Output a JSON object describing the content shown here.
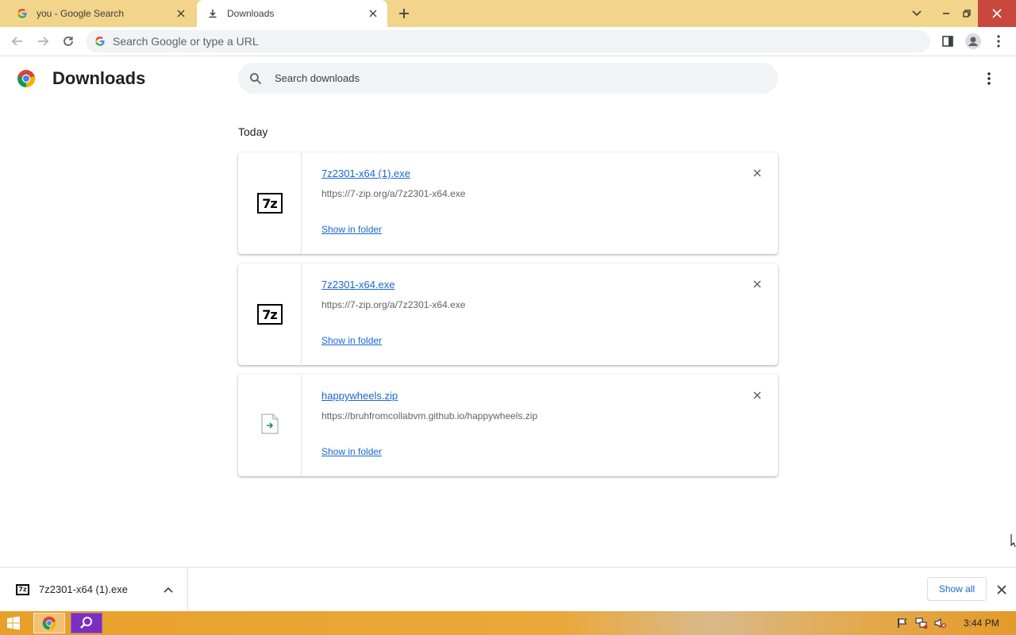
{
  "tabs": [
    {
      "title": "you - Google Search",
      "icon": "google-g-icon",
      "active": false
    },
    {
      "title": "Downloads",
      "icon": "download-icon",
      "active": true
    }
  ],
  "omnibox": {
    "placeholder": "Search Google or type a URL",
    "value": ""
  },
  "page": {
    "title": "Downloads",
    "search_placeholder": "Search downloads",
    "section_label": "Today"
  },
  "downloads": [
    {
      "name": "7z2301-x64 (1).exe",
      "url": "https://7-zip.org/a/7z2301-x64.exe",
      "action": "Show in folder",
      "icon": "7zip-icon"
    },
    {
      "name": "7z2301-x64.exe",
      "url": "https://7-zip.org/a/7z2301-x64.exe",
      "action": "Show in folder",
      "icon": "7zip-icon"
    },
    {
      "name": "happywheels.zip",
      "url": "https://bruhfromcollabvm.github.io/happywheels.zip",
      "action": "Show in folder",
      "icon": "file-icon"
    }
  ],
  "shelf": {
    "item_name": "7z2301-x64 (1).exe",
    "show_all": "Show all"
  },
  "icon_text": {
    "sevenzip": "7z"
  },
  "taskbar": {
    "clock": "3:44 PM"
  },
  "colors": {
    "link": "#1967d2",
    "tabstrip": "#f2d48a",
    "accent": "#1a73e8"
  }
}
